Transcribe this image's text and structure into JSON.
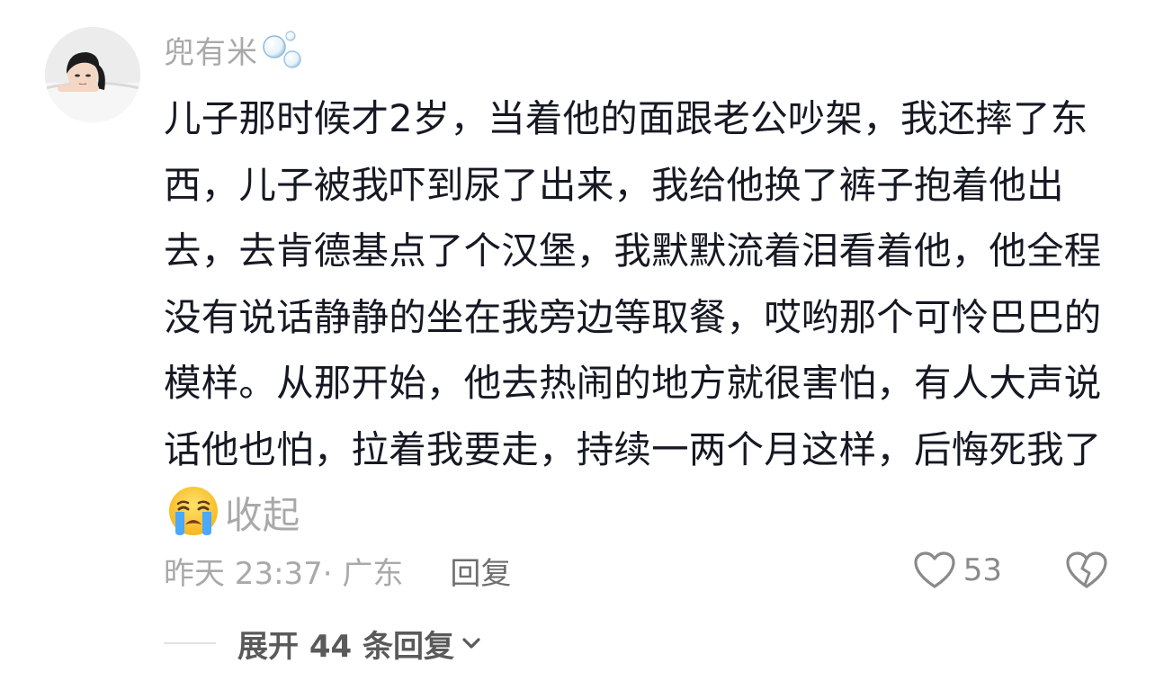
{
  "comment": {
    "username": "兜有米",
    "text": "儿子那时候才2岁，当着他的面跟老公吵架，我还摔了东西，儿子被我吓到尿了出来，我给他换了裤子抱着他出去，去肯德基点了个汉堡，我默默流着泪看着他，他全程没有说话静静的坐在我旁边等取餐，哎哟那个可怜巴巴的模样。从那开始，他去热闹的地方就很害怕，有人大声说话他也怕，拉着我要走，持续一两个月这样，后悔死我了",
    "emoji_icon": "loudly-crying-face-emoji",
    "collapse_label": "收起",
    "time_location": "昨天 23:37· 广东",
    "reply_label": "回复",
    "like_count": "53",
    "expand_replies_label": "展开 44 条回复"
  },
  "colors": {
    "text_primary": "#161823",
    "text_secondary": "#a9a9a9",
    "emoji_yellow": "#ffcc33",
    "emoji_tear": "#4aa8ff"
  }
}
